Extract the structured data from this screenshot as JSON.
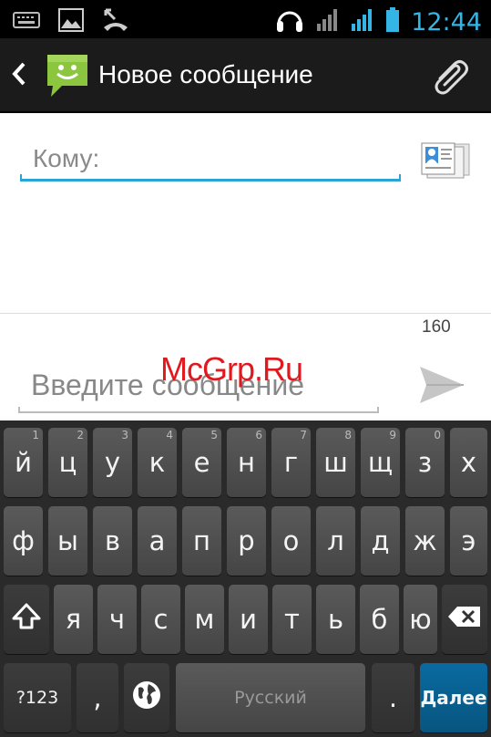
{
  "status_bar": {
    "time": "12:44",
    "icons": [
      "keyboard-icon",
      "image-icon",
      "missed-call-icon",
      "headset-icon",
      "signal-icon",
      "signal-icon",
      "battery-icon"
    ]
  },
  "action_bar": {
    "title": "Новое сообщение",
    "icons": [
      "back-arrow-icon",
      "messaging-app-icon",
      "paperclip-icon"
    ]
  },
  "compose": {
    "to_label": "Кому:",
    "char_counter": "160",
    "message_placeholder": "Введите сообщение"
  },
  "watermark": "McGrp.Ru",
  "keyboard": {
    "row1": [
      {
        "label": "й",
        "hint": "1"
      },
      {
        "label": "ц",
        "hint": "2"
      },
      {
        "label": "у",
        "hint": "3"
      },
      {
        "label": "к",
        "hint": "4"
      },
      {
        "label": "е",
        "hint": "5"
      },
      {
        "label": "н",
        "hint": "6"
      },
      {
        "label": "г",
        "hint": "7"
      },
      {
        "label": "ш",
        "hint": "8"
      },
      {
        "label": "щ",
        "hint": "9"
      },
      {
        "label": "з",
        "hint": "0"
      },
      {
        "label": "х",
        "hint": ""
      }
    ],
    "row2": [
      "ф",
      "ы",
      "в",
      "а",
      "п",
      "р",
      "о",
      "л",
      "д",
      "ж",
      "э"
    ],
    "row3": [
      "я",
      "ч",
      "с",
      "м",
      "и",
      "т",
      "ь",
      "б",
      "ю"
    ],
    "symbols_label": "?123",
    "comma_label": ",",
    "space_label": "Русский",
    "period_label": ".",
    "enter_label": "Далее"
  },
  "colors": {
    "accent": "#33b5e5",
    "underline_active": "#2aa3d6",
    "enter_key": "#0a6aa0"
  }
}
